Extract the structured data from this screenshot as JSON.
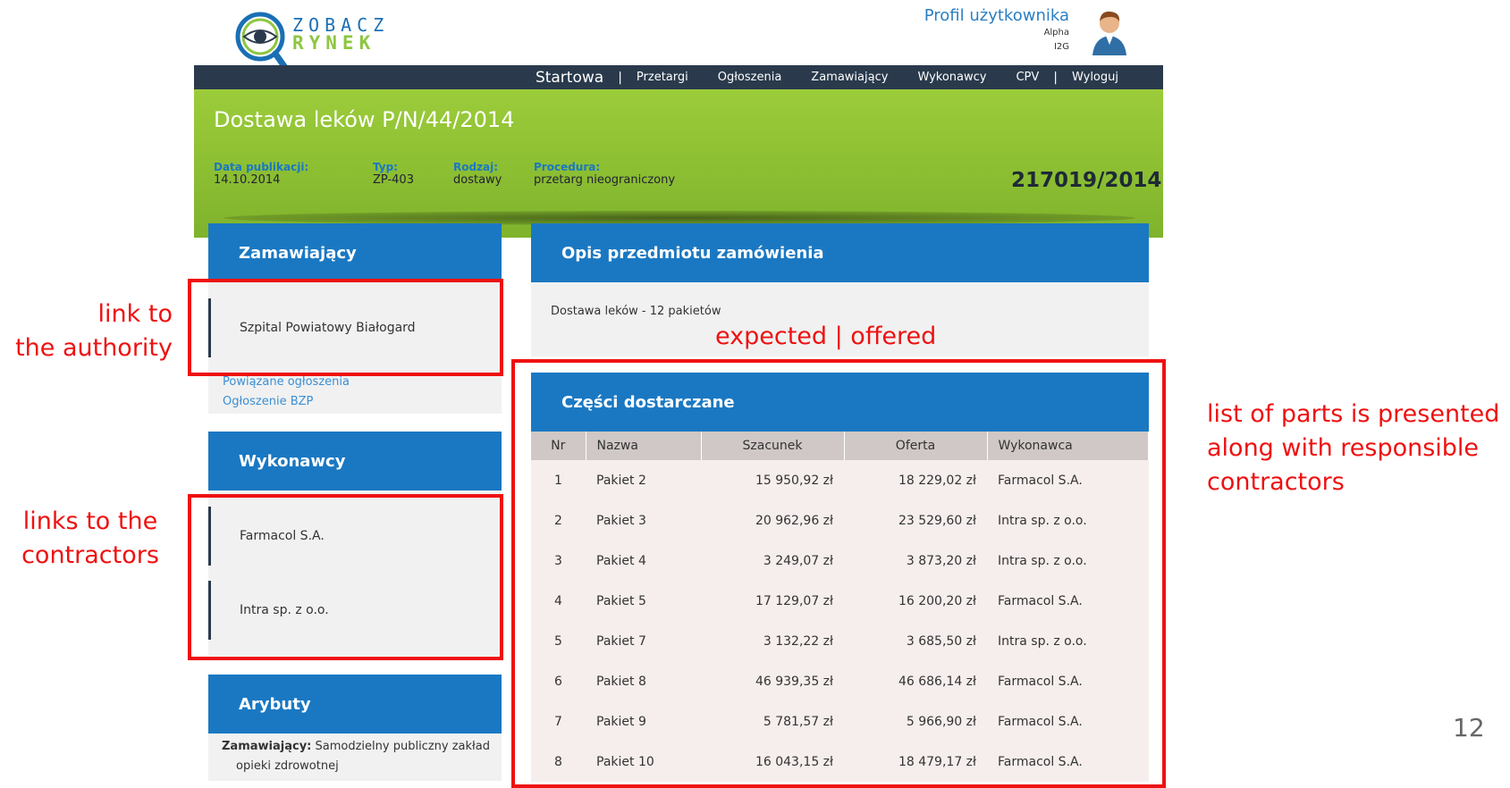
{
  "header": {
    "logo_top": "ZOBACZ",
    "logo_bottom": "RYNEK",
    "profile_link": "Profil użytkownika",
    "profile_name": "Alpha",
    "profile_code": "I2G"
  },
  "nav": {
    "items": [
      "Startowa",
      "|",
      "Przetargi",
      "Ogłoszenia",
      "Zamawiający",
      "Wykonawcy",
      "CPV",
      "|",
      "Wyloguj"
    ]
  },
  "notice": {
    "title": "Dostawa leków P/N/44/2014",
    "meta": [
      {
        "label": "Data publikacji:",
        "value": "14.10.2014"
      },
      {
        "label": "Typ:",
        "value": "ZP-403"
      },
      {
        "label": "Rodzaj:",
        "value": "dostawy"
      },
      {
        "label": "Procedura:",
        "value": "przetarg nieograniczony"
      }
    ],
    "number": "217019/2014"
  },
  "authority_panel": {
    "title": "Zamawiający",
    "authority": "Szpital Powiatowy Białogard",
    "links": [
      "Powiązane ogłoszenia",
      "Ogłoszenie BZP"
    ]
  },
  "contractors_panel": {
    "title": "Wykonawcy",
    "contractors": [
      "Farmacol S.A.",
      "Intra sp. z o.o."
    ]
  },
  "attributes_panel": {
    "title": "Arybuty",
    "label": "Zamawiający:",
    "value_line1": "Samodzielny publiczny zakład",
    "value_line2": "opieki zdrowotnej"
  },
  "description_panel": {
    "title": "Opis przedmiotu zamówienia",
    "text": "Dostawa leków - 12 pakietów"
  },
  "parts_panel": {
    "title": "Części dostarczane",
    "headers": [
      "Nr",
      "Nazwa",
      "Szacunek",
      "Oferta",
      "Wykonawca"
    ],
    "rows": [
      [
        "1",
        "Pakiet 2",
        "15 950,92 zł",
        "18 229,02 zł",
        "Farmacol S.A."
      ],
      [
        "2",
        "Pakiet 3",
        "20 962,96 zł",
        "23 529,60 zł",
        "Intra sp. z o.o."
      ],
      [
        "3",
        "Pakiet 4",
        "3 249,07 zł",
        "3 873,20 zł",
        "Intra sp. z o.o."
      ],
      [
        "4",
        "Pakiet 5",
        "17 129,07 zł",
        "16 200,20 zł",
        "Farmacol S.A."
      ],
      [
        "5",
        "Pakiet 7",
        "3 132,22 zł",
        "3 685,50 zł",
        "Intra sp. z o.o."
      ],
      [
        "6",
        "Pakiet 8",
        "46 939,35 zł",
        "46 686,14 zł",
        "Farmacol S.A."
      ],
      [
        "7",
        "Pakiet 9",
        "5 781,57 zł",
        "5 966,90 zł",
        "Farmacol S.A."
      ],
      [
        "8",
        "Pakiet 10",
        "16 043,15 zł",
        "18 479,17 zł",
        "Farmacol S.A."
      ]
    ]
  },
  "annotations": {
    "authority_l1": "link to",
    "authority_l2": "the authority",
    "contractors_l1": "links to the",
    "contractors_l2": "contractors",
    "expected": "expected | offered",
    "parts_l1": "list of parts is presented",
    "parts_l2": "along with responsible",
    "parts_l3": "contractors"
  },
  "slide_number": "12",
  "colors": {
    "nav_bg": "#2a3a4c",
    "banner_green": "#8dc63f",
    "panel_blue": "#1a78c2",
    "annotation_red": "#ee1111"
  }
}
